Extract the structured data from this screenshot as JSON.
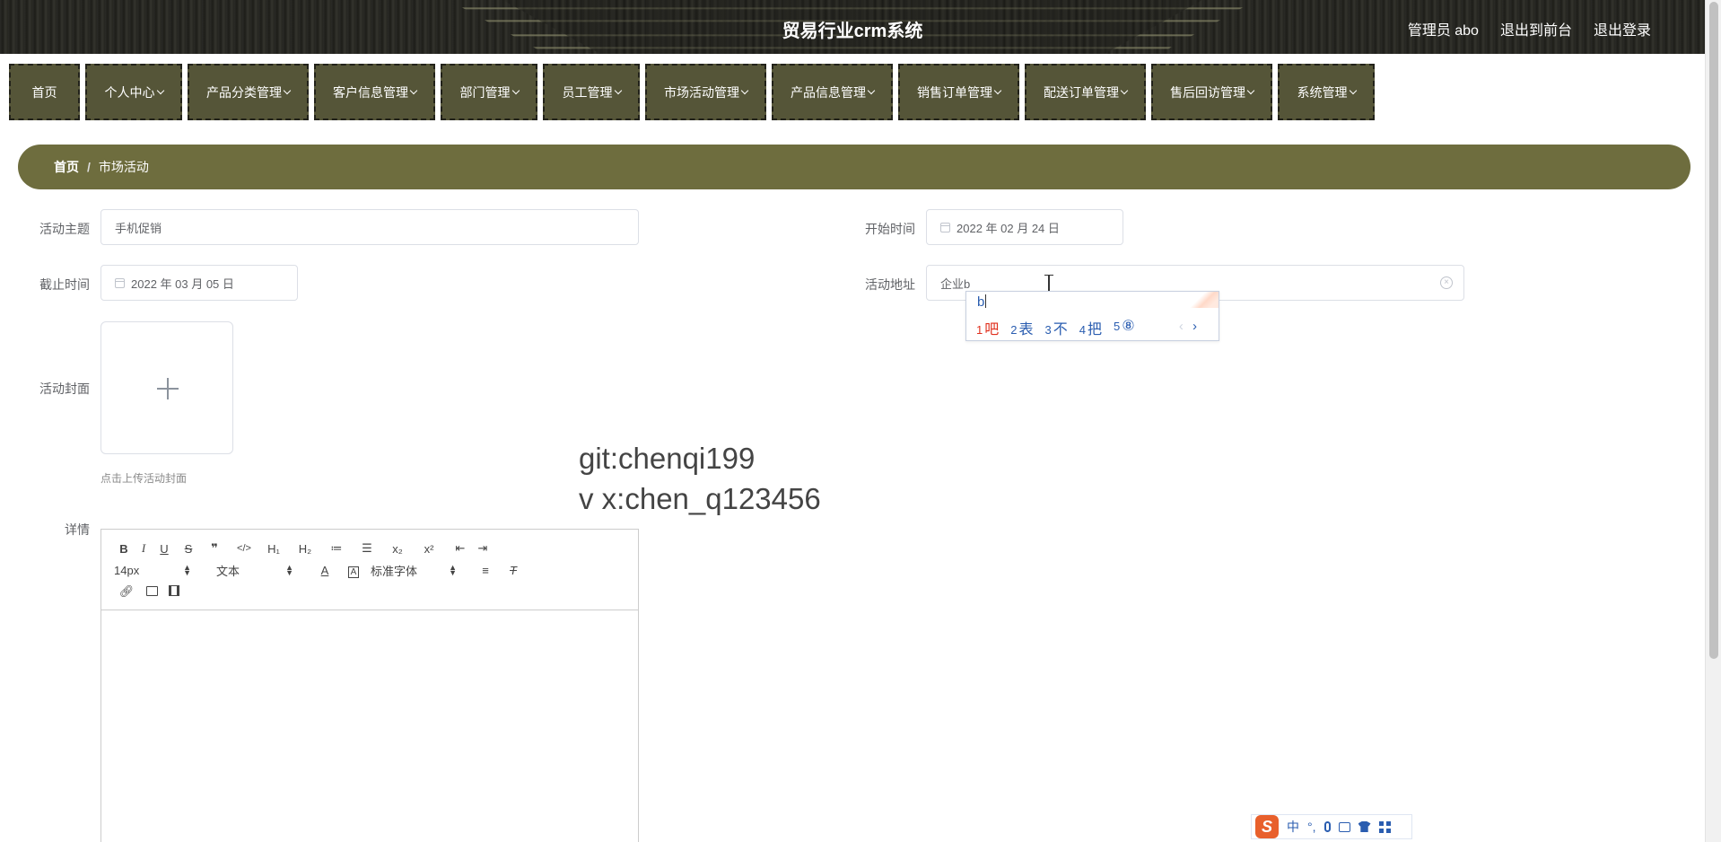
{
  "header": {
    "app_title": "贸易行业crm系统",
    "user_label": "管理员 abo",
    "back_to_front": "退出到前台",
    "logout": "退出登录"
  },
  "menu": {
    "items": [
      {
        "label": "首页",
        "has_dropdown": false
      },
      {
        "label": "个人中心",
        "has_dropdown": true
      },
      {
        "label": "产品分类管理",
        "has_dropdown": true
      },
      {
        "label": "客户信息管理",
        "has_dropdown": true
      },
      {
        "label": "部门管理",
        "has_dropdown": true
      },
      {
        "label": "员工管理",
        "has_dropdown": true
      },
      {
        "label": "市场活动管理",
        "has_dropdown": true
      },
      {
        "label": "产品信息管理",
        "has_dropdown": true
      },
      {
        "label": "销售订单管理",
        "has_dropdown": true
      },
      {
        "label": "配送订单管理",
        "has_dropdown": true
      },
      {
        "label": "售后回访管理",
        "has_dropdown": true
      },
      {
        "label": "系统管理",
        "has_dropdown": true
      }
    ]
  },
  "breadcrumb": {
    "home": "首页",
    "separator": "/",
    "current": "市场活动"
  },
  "form": {
    "subject": {
      "label": "活动主题",
      "value": "手机促销"
    },
    "start_time": {
      "label": "开始时间",
      "value": "2022 年 02 月 24 日"
    },
    "end_time": {
      "label": "截止时间",
      "value": "2022 年 03 月 05 日"
    },
    "address": {
      "label": "活动地址",
      "value": "企业b"
    },
    "cover": {
      "label": "活动封面",
      "tip": "点击上传活动封面"
    },
    "detail": {
      "label": "详情"
    }
  },
  "watermark": {
    "line1": "git:chenqi199",
    "line2": "v x:chen_q123456"
  },
  "editor": {
    "font_size": "14px",
    "header_select": "文本",
    "font_family": "标准字体",
    "buttons_row1": [
      {
        "name": "bold-button",
        "glyph": "B"
      },
      {
        "name": "italic-button",
        "glyph": "I"
      },
      {
        "name": "underline-button",
        "glyph": "U"
      },
      {
        "name": "strike-button",
        "glyph": "S"
      },
      {
        "name": "blockquote-button",
        "glyph": "❞"
      },
      {
        "name": "code-block-button",
        "glyph": "</>"
      },
      {
        "name": "header1-button",
        "glyph": "H₁"
      },
      {
        "name": "header2-button",
        "glyph": "H₂"
      },
      {
        "name": "ordered-list-button",
        "glyph": "≔"
      },
      {
        "name": "bullet-list-button",
        "glyph": "☰"
      },
      {
        "name": "subscript-button",
        "glyph": "x₂"
      },
      {
        "name": "superscript-button",
        "glyph": "x²"
      },
      {
        "name": "outdent-button",
        "glyph": "⇤"
      },
      {
        "name": "indent-button",
        "glyph": "⇥"
      }
    ]
  },
  "ime": {
    "composition": "b",
    "candidates": [
      {
        "num": "1",
        "text": "吧"
      },
      {
        "num": "2",
        "text": "表"
      },
      {
        "num": "3",
        "text": "不"
      },
      {
        "num": "4",
        "text": "把"
      },
      {
        "num": "5",
        "text": "⑧"
      }
    ],
    "prev": "‹",
    "next": "›",
    "bar": {
      "logo": "S",
      "lang": "中",
      "punct": "°,"
    }
  },
  "colors": {
    "menu_bg": "#555538",
    "breadcrumb_bg": "#6e6d3e",
    "ime_first_candidate": "#e0301e",
    "ime_candidate": "#2a5db0"
  }
}
